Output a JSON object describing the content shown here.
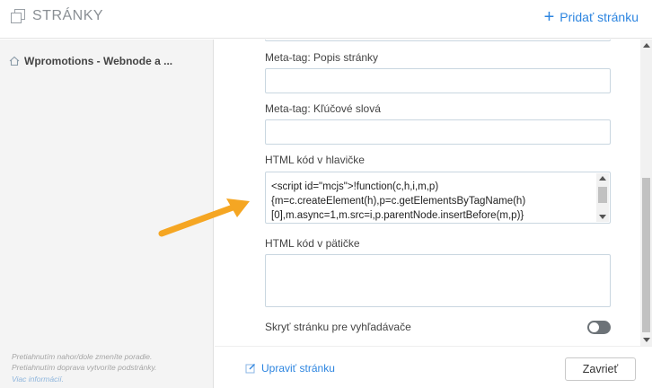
{
  "header": {
    "title": "STRÁNKY",
    "add_page_label": "Pridať stránku",
    "icon": "pages-icon"
  },
  "sidebar": {
    "items": [
      {
        "label": "Wpromotions - Webnode a ...",
        "icon": "home-icon"
      }
    ],
    "help_line1": "Pretiahnutím nahor/dole zmeníte poradie.",
    "help_line2": "Pretiahnutím doprava vytvoríte podstránky.",
    "help_link": "Viac informácií."
  },
  "form": {
    "meta_description_label": "Meta-tag: Popis stránky",
    "meta_description_value": "",
    "meta_keywords_label": "Meta-tag: Kľúčové slová",
    "meta_keywords_value": "",
    "html_head_label": "HTML kód v hlavičke",
    "html_head_value": "<script id=\"mcjs\">!function(c,h,i,m,p)\n{m=c.createElement(h),p=c.getElementsByTagName(h)\n[0],m.async=1,m.src=i,p.parentNode.insertBefore(m,p)}",
    "html_footer_label": "HTML kód v pätičke",
    "html_footer_value": "",
    "hide_search_label": "Skryť stránku pre vyhľadávače",
    "hide_search_enabled": false
  },
  "footer": {
    "edit_page_label": "Upraviť stránku",
    "close_label": "Zavrieť"
  },
  "colors": {
    "accent": "#2d85e0",
    "arrow": "#f5a623",
    "toggle_off": "#6d7378"
  }
}
